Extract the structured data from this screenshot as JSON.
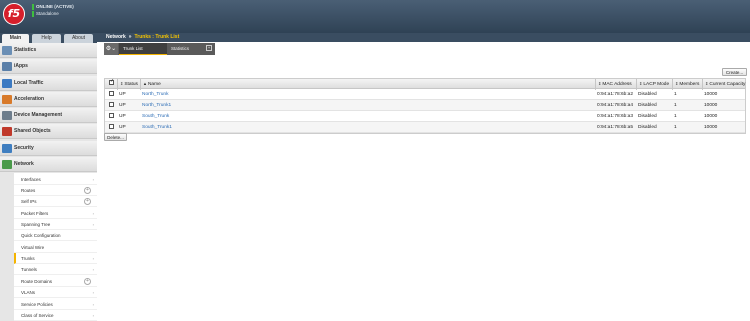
{
  "banner": {
    "logo": "f5",
    "status": "ONLINE (ACTIVE)",
    "mode": "Standalone"
  },
  "nav": {
    "tabs": [
      "Main",
      "Help",
      "About"
    ],
    "sections": [
      {
        "label": "Statistics",
        "icon": "statistics-icon",
        "color": "#6b8fb5"
      },
      {
        "label": "iApps",
        "icon": "iapps-icon",
        "color": "#5a7fa8"
      },
      {
        "label": "Local Traffic",
        "icon": "local-traffic-icon",
        "color": "#3c7ac2"
      },
      {
        "label": "Acceleration",
        "icon": "acceleration-icon",
        "color": "#d87a2a"
      },
      {
        "label": "Device Management",
        "icon": "device-management-icon",
        "color": "#6d7d8c"
      },
      {
        "label": "Shared Objects",
        "icon": "shared-objects-icon",
        "color": "#c0392b"
      },
      {
        "label": "Security",
        "icon": "security-icon",
        "color": "#3f7ec0"
      },
      {
        "label": "Network",
        "icon": "network-icon",
        "color": "#4a9a4a"
      }
    ],
    "network_items": [
      {
        "label": "Interfaces",
        "marker": "arrow"
      },
      {
        "label": "Routes",
        "marker": "plus"
      },
      {
        "label": "Self IPs",
        "marker": "plus"
      },
      {
        "label": "Packet Filters",
        "marker": "arrow"
      },
      {
        "label": "Spanning Tree",
        "marker": "arrow"
      },
      {
        "label": "Quick Configuration",
        "marker": ""
      },
      {
        "label": "Virtual Wire",
        "marker": ""
      },
      {
        "label": "Trunks",
        "marker": "arrow"
      },
      {
        "label": "Tunnels",
        "marker": "arrow"
      },
      {
        "label": "Route Domains",
        "marker": "plus"
      },
      {
        "label": "VLANs",
        "marker": "arrow"
      },
      {
        "label": "Service Policies",
        "marker": "arrow"
      },
      {
        "label": "Class of Service",
        "marker": "arrow"
      }
    ]
  },
  "breadcrumb": {
    "root": "Network",
    "separator": "»",
    "current": "Trunks : Trunk List"
  },
  "page_tabs": {
    "gear": "⚙",
    "gear_caret": "⌄",
    "trunk_list": "Trunk List",
    "statistics": "Statistics",
    "statistics_ext": "+"
  },
  "buttons": {
    "create": "Create...",
    "delete": "Delete..."
  },
  "table": {
    "columns": {
      "status": "Status",
      "name": "Name",
      "name_sort": "▲",
      "mac": "MAC Address",
      "lacp": "LACP Mode",
      "members": "Members",
      "capacity": "Current Capacity"
    },
    "rows": [
      {
        "status": "UP",
        "name": "North_Trunk",
        "mac": "0:94:a1:78:6b:a2",
        "lacp": "Disabled",
        "members": "1",
        "capacity": "10000"
      },
      {
        "status": "UP",
        "name": "North_Trunk1",
        "mac": "0:94:a1:78:6b:a4",
        "lacp": "Disabled",
        "members": "1",
        "capacity": "10000"
      },
      {
        "status": "UP",
        "name": "South_Trunk",
        "mac": "0:94:a1:78:6b:a3",
        "lacp": "Disabled",
        "members": "1",
        "capacity": "10000"
      },
      {
        "status": "UP",
        "name": "South_Trunk1",
        "mac": "0:94:a1:78:6b:a5",
        "lacp": "Disabled",
        "members": "1",
        "capacity": "10000"
      }
    ]
  }
}
